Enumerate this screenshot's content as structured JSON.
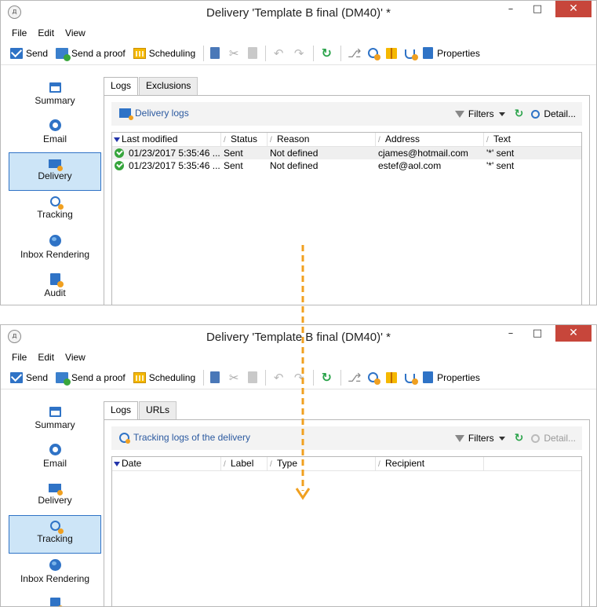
{
  "window": {
    "title": "Delivery 'Template B final (DM40)' *",
    "app_icon_glyph": "д",
    "minimize_glyph": "–",
    "maximize_glyph": "□",
    "close_glyph": "✕"
  },
  "menu": [
    "File",
    "Edit",
    "View"
  ],
  "toolbar": {
    "send": "Send",
    "send_proof": "Send a proof",
    "scheduling": "Scheduling",
    "properties": "Properties",
    "cut_glyph": "✂",
    "undo_glyph": "↶",
    "redo_glyph": "↷",
    "refresh_glyph": "↻",
    "attach_glyph": "⎇"
  },
  "sidebar": {
    "items": [
      {
        "label": "Summary",
        "icon": "summary-icon"
      },
      {
        "label": "Email",
        "icon": "email-icon"
      },
      {
        "label": "Delivery",
        "icon": "delivery-icon"
      },
      {
        "label": "Tracking",
        "icon": "tracking-icon"
      },
      {
        "label": "Inbox Rendering",
        "icon": "globe-icon"
      },
      {
        "label": "Audit",
        "icon": "audit-icon"
      }
    ]
  },
  "top": {
    "active_sidebar": "Delivery",
    "tabs": [
      "Logs",
      "Exclusions"
    ],
    "panel_link": "Delivery logs",
    "filters": "Filters",
    "detail": "Detail...",
    "columns": [
      "Last modified",
      "Status",
      "Reason",
      "Address",
      "Text"
    ],
    "rows": [
      {
        "last_modified": "01/23/2017 5:35:46 ...",
        "status": "Sent",
        "reason": "Not defined",
        "address": "cjames@hotmail.com",
        "text": "'*' sent"
      },
      {
        "last_modified": "01/23/2017 5:35:46 ...",
        "status": "Sent",
        "reason": "Not defined",
        "address": "estef@aol.com",
        "text": "'*' sent"
      }
    ]
  },
  "bottom": {
    "active_sidebar": "Tracking",
    "tabs": [
      "Logs",
      "URLs"
    ],
    "panel_link": "Tracking logs of the delivery",
    "filters": "Filters",
    "detail": "Detail...",
    "columns": [
      "Date",
      "Label",
      "Type",
      "Recipient"
    ]
  },
  "colors": {
    "accent": "#2f73c6",
    "active_bg": "#cde5f7",
    "arrow": "#f0a020",
    "close_button": "#c7463b",
    "ok_status": "#36a53c"
  }
}
